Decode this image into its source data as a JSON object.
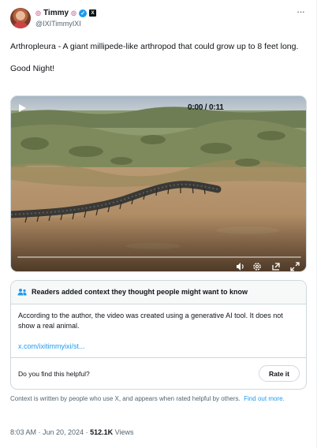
{
  "author": {
    "name": "Timmy",
    "emoji_left": "◎",
    "emoji_right": "◎",
    "handle": "@IXITimmyIXI",
    "verified_icon": "verified-badge-icon",
    "affiliate_badge": "X"
  },
  "more_label": "···",
  "post": {
    "line1": "Arthropleura - A giant millipede-like arthropod that could grow up to 8 feet long.",
    "line2": "Good Night!"
  },
  "video": {
    "time": "0:00 / 0:11",
    "progress": 0
  },
  "community_note": {
    "title": "Readers added context they thought people might want to know",
    "body": "According to the author, the video was created using a generative AI tool. It does not show a real animal.",
    "link": "x.com/ixitimmyixi/st...",
    "question": "Do you find this helpful?",
    "rate_label": "Rate it"
  },
  "context_note": {
    "text": "Context is written by people who use X, and appears when rated helpful by others.",
    "link": "Find out more."
  },
  "meta": {
    "time": "8:03 AM · Jun 20, 2024",
    "sep": " · ",
    "views_count": "512.1K",
    "views_label": "Views"
  },
  "colors": {
    "accent": "#1d9bf0",
    "text": "#0f1419",
    "secondary": "#536471",
    "border": "#cfd9de"
  }
}
